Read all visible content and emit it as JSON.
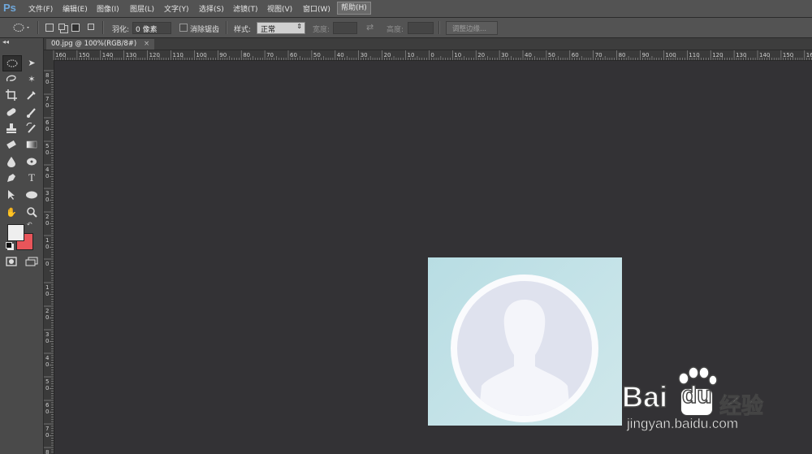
{
  "app": {
    "logo": "Ps"
  },
  "menu": [
    "文件(F)",
    "编辑(E)",
    "图像(I)",
    "图层(L)",
    "文字(Y)",
    "选择(S)",
    "滤镜(T)",
    "视图(V)",
    "窗口(W)",
    "帮助(H)"
  ],
  "options": {
    "feather_label": "羽化:",
    "feather_value": "0 像素",
    "antialias_label": "消除锯齿",
    "style_label": "样式:",
    "style_value": "正常",
    "width_label": "宽度:",
    "height_label": "高度:",
    "refine_button": "调整边缘..."
  },
  "document": {
    "tab_title": "00.jpg @ 100%(RGB/8#)",
    "close": "×"
  },
  "ruler": {
    "horizontal": [
      "160",
      "150",
      "140",
      "130",
      "120",
      "110",
      "100",
      "90",
      "80",
      "70",
      "60",
      "50",
      "40",
      "30",
      "20",
      "10",
      "0",
      "10",
      "20",
      "30",
      "40",
      "50",
      "60",
      "70",
      "80",
      "90",
      "100",
      "110",
      "120",
      "130",
      "140",
      "150",
      "160"
    ],
    "vertical": [
      [
        "8",
        "0"
      ],
      [
        "7",
        "0"
      ],
      [
        "6",
        "0"
      ],
      [
        "5",
        "0"
      ],
      [
        "4",
        "0"
      ],
      [
        "3",
        "0"
      ],
      [
        "2",
        "0"
      ],
      [
        "1",
        "0"
      ],
      [
        "0",
        ""
      ],
      [
        "1",
        "0"
      ],
      [
        "2",
        "0"
      ],
      [
        "3",
        "0"
      ],
      [
        "4",
        "0"
      ],
      [
        "5",
        "0"
      ],
      [
        "6",
        "0"
      ],
      [
        "7",
        "0"
      ],
      [
        "8",
        ""
      ]
    ]
  },
  "toolbar": {
    "icons": [
      "elliptical-marquee-icon",
      "move-icon",
      "lasso-icon",
      "magic-wand-icon",
      "crop-icon",
      "eyedropper-icon",
      "spot-healing-icon",
      "brush-icon",
      "clone-stamp-icon",
      "history-brush-icon",
      "eraser-icon",
      "gradient-icon",
      "blur-icon",
      "dodge-icon",
      "pen-icon",
      "type-icon",
      "path-selection-icon",
      "ellipse-shape-icon",
      "hand-icon",
      "zoom-icon"
    ],
    "foreground_color": "#eeeeee",
    "background_color": "#e8555a"
  },
  "watermark": {
    "brand": "Bai",
    "brand2": "du",
    "cn": "经验",
    "url": "jingyan.baidu.com"
  }
}
